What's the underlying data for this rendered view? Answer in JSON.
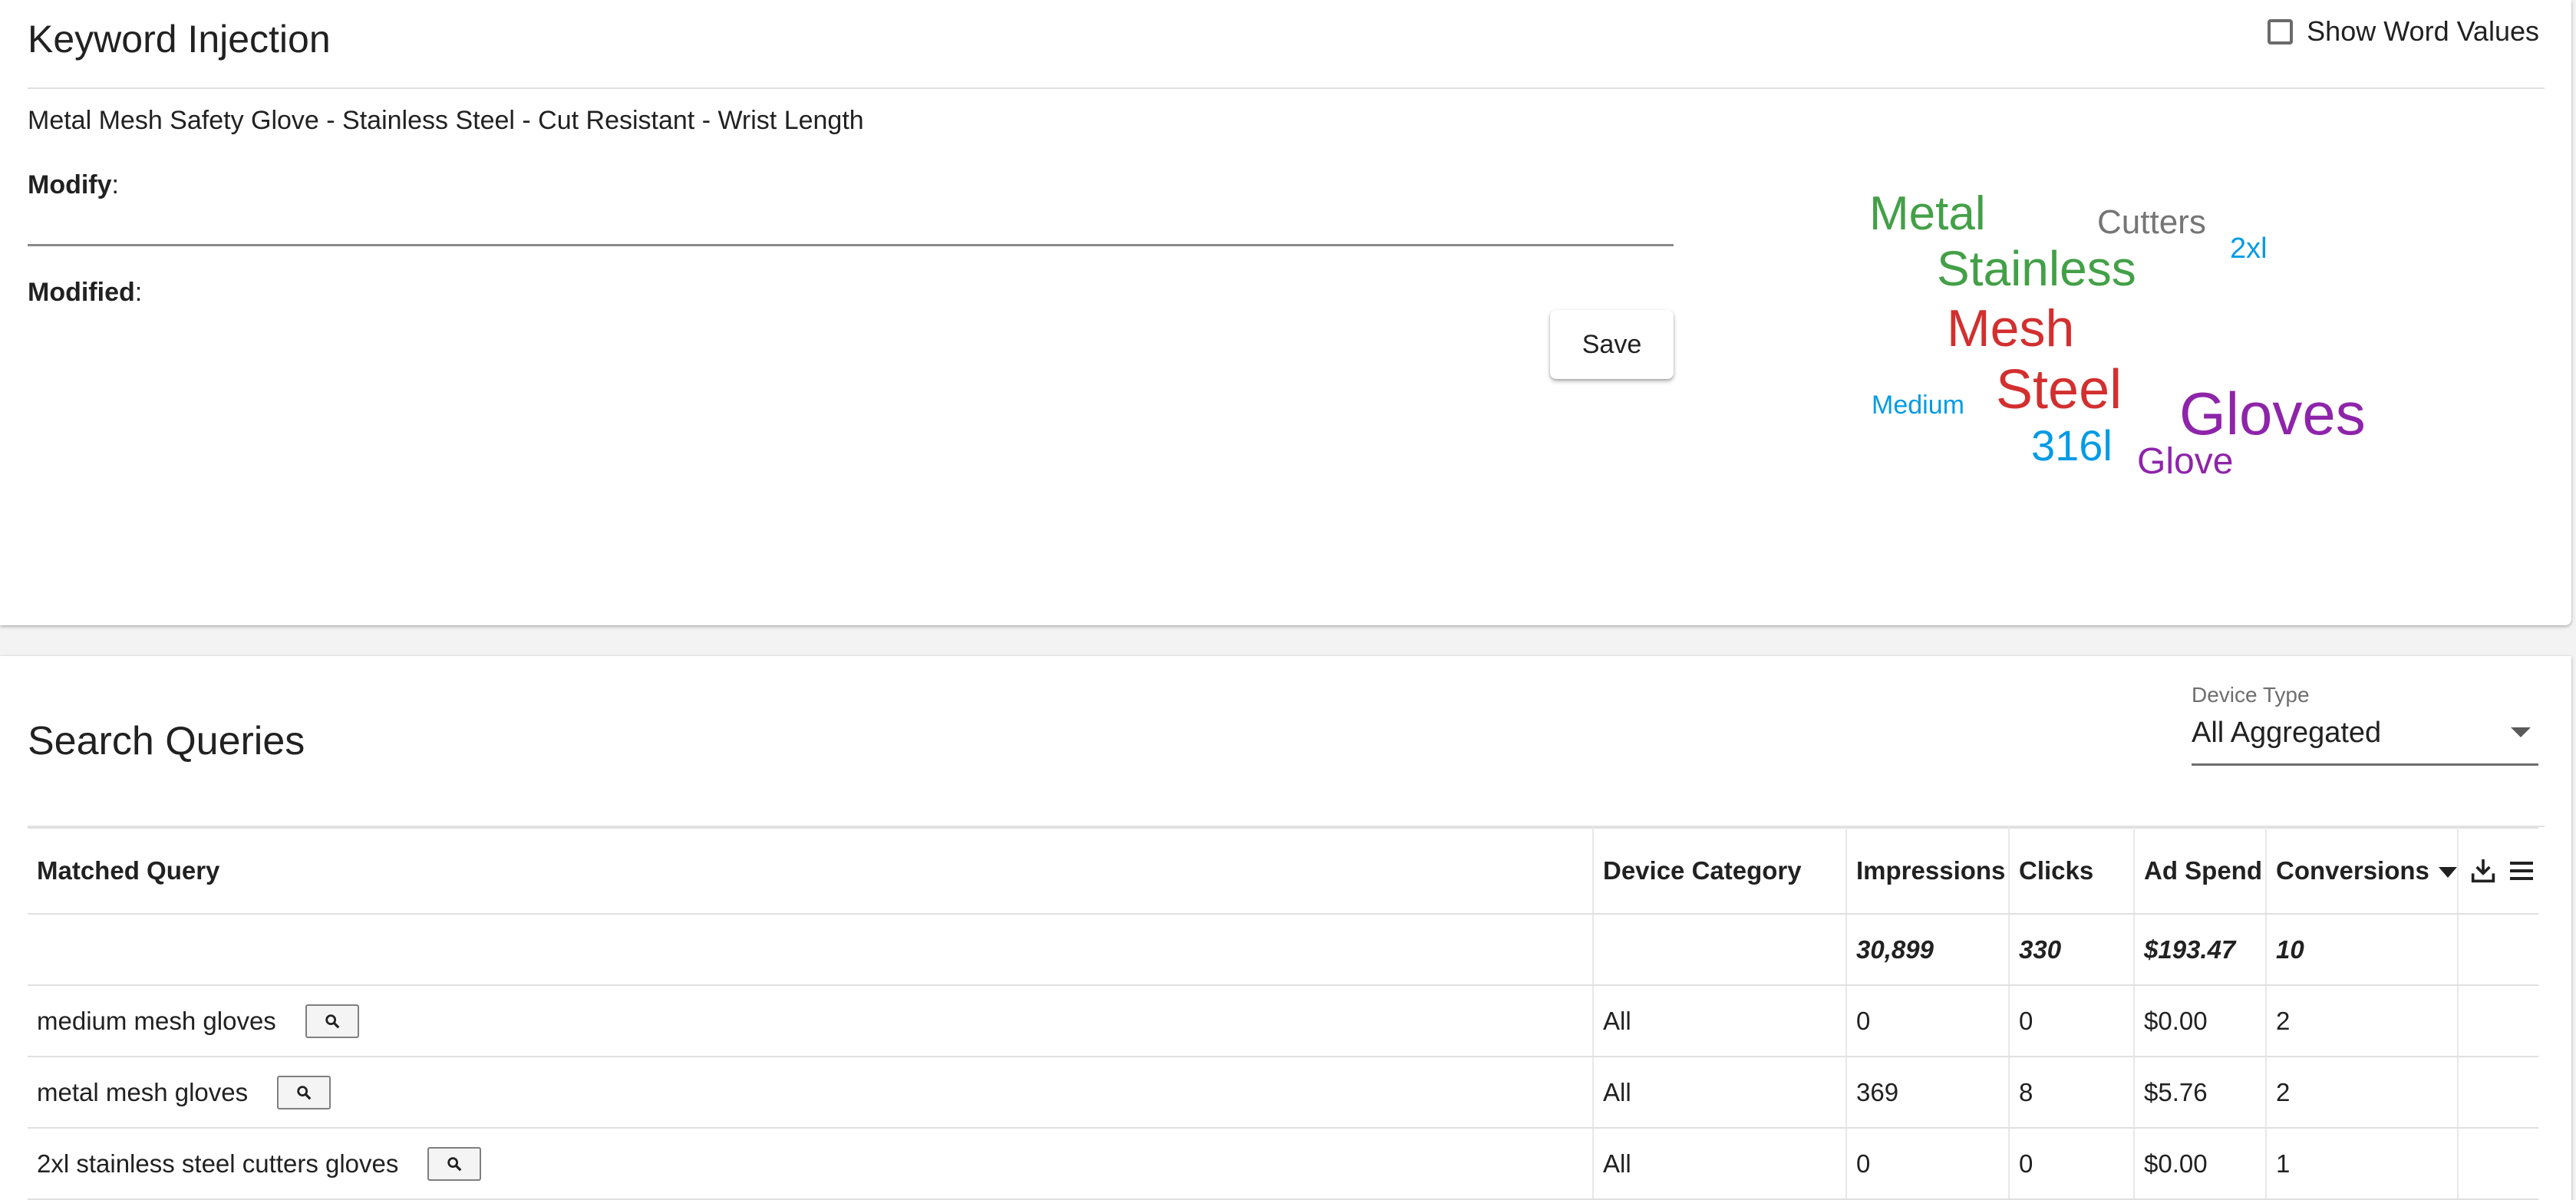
{
  "keyword_injection": {
    "title": "Keyword Injection",
    "show_word_values_label": "Show Word Values",
    "product_title": "Metal Mesh Safety Glove - Stainless Steel - Cut Resistant - Wrist Length",
    "modify_label": "Modify",
    "modify_value": "",
    "modified_label": "Modified",
    "save_label": "Save"
  },
  "word_cloud": {
    "colors": {
      "green": "#43a047",
      "red": "#d32f2f",
      "purple": "#8e24aa",
      "blue": "#039be5",
      "gray": "#757575"
    },
    "words": [
      "Metal",
      "Cutters",
      "2xl",
      "Stainless",
      "Mesh",
      "Steel",
      "Gloves",
      "Medium",
      "316l",
      "Glove"
    ]
  },
  "search_queries": {
    "title": "Search Queries",
    "device_type": {
      "label": "Device Type",
      "value": "All Aggregated"
    },
    "columns": [
      "Matched Query",
      "Device Category",
      "Impressions",
      "Clicks",
      "Ad Spend",
      "Conversions"
    ],
    "totals": {
      "impressions": "30,899",
      "clicks": "330",
      "ad_spend": "$193.47",
      "conversions": "10"
    },
    "rows": [
      {
        "query": "medium mesh gloves",
        "device": "All",
        "impressions": "0",
        "clicks": "0",
        "ad_spend": "$0.00",
        "conversions": "2"
      },
      {
        "query": "metal mesh gloves",
        "device": "All",
        "impressions": "369",
        "clicks": "8",
        "ad_spend": "$5.76",
        "conversions": "2"
      },
      {
        "query": "2xl stainless steel cutters gloves",
        "device": "All",
        "impressions": "0",
        "clicks": "0",
        "ad_spend": "$0.00",
        "conversions": "1"
      }
    ]
  }
}
